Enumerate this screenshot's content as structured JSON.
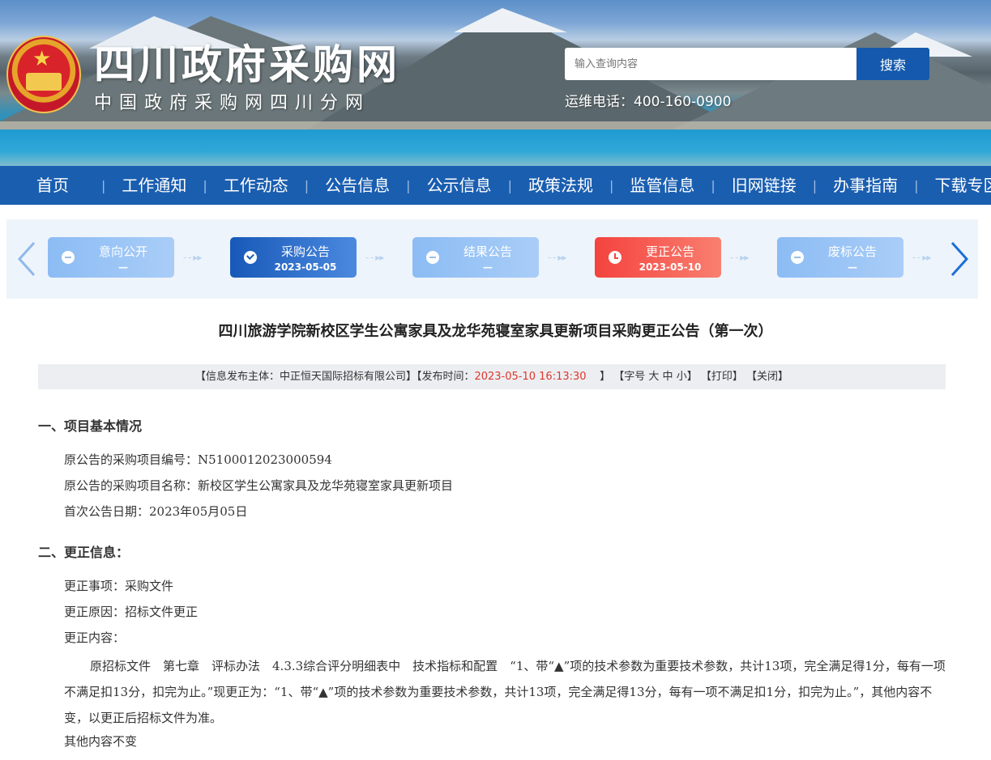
{
  "header": {
    "site_title": "四川政府采购网",
    "site_subtitle": "中国政府采购网四川分网",
    "search_placeholder": "输入查询内容",
    "search_button": "搜索",
    "hotline": "运维电话：400-160-0900"
  },
  "nav": {
    "items": [
      "首页",
      "工作通知",
      "工作动态",
      "公告信息",
      "公示信息",
      "政策法规",
      "监管信息",
      "旧网链接",
      "办事指南",
      "下载专区"
    ],
    "separator": "|"
  },
  "stepper": {
    "steps": [
      {
        "title": "意向公开",
        "date": "—",
        "state": "inactive"
      },
      {
        "title": "采购公告",
        "date": "2023-05-05",
        "state": "done"
      },
      {
        "title": "结果公告",
        "date": "—",
        "state": "inactive"
      },
      {
        "title": "更正公告",
        "date": "2023-05-10",
        "state": "current"
      },
      {
        "title": "废标公告",
        "date": "—",
        "state": "inactive"
      }
    ],
    "colors": {
      "inactive": "#8cbcf4",
      "done": "#1859b8",
      "current": "#f4433f"
    }
  },
  "article": {
    "title": "四川旅游学院新校区学生公寓家具及龙华苑寝室家具更新项目采购更正公告（第一次）",
    "meta": {
      "publisher_prefix": "【信息发布主体：中正恒天国际招标有限公司】【发布时间：",
      "publish_time": "2023-05-10 16:13:30",
      "publish_suffix": "】",
      "font_size_label": "【字号",
      "font_large": "大",
      "font_medium": "中",
      "font_small": "小",
      "font_size_close": "】",
      "print": "【打印】",
      "close": "【关闭】"
    },
    "section1": {
      "heading": "一、项目基本情况",
      "lines": [
        "原公告的采购项目编号：N5100012023000594",
        "原公告的采购项目名称：新校区学生公寓家具及龙华苑寝室家具更新项目",
        "首次公告日期：2023年05月05日"
      ]
    },
    "section2": {
      "heading": "二、更正信息：",
      "lines": [
        "更正事项：采购文件",
        "更正原因：招标文件更正",
        "更正内容："
      ],
      "body": "原招标文件　第七章　评标办法　4.3.3综合评分明细表中　技术指标和配置　“1、带“▲”项的技术参数为重要技术参数，共计13项，完全满足得1分，每有一项不满足扣13分，扣完为止。”现更正为：“1、带“▲”项的技术参数为重要技术参数，共计13项，完全满足得13分，每有一项不满足扣1分，扣完为止。”，其他内容不变，以更正后招标文件为准。",
      "footer": "其他内容不变"
    }
  }
}
